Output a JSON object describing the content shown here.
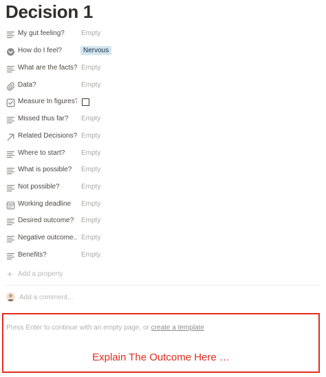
{
  "page": {
    "title": "Decision 1"
  },
  "properties": [
    {
      "icon": "text-lines-icon",
      "label": "My gut feeling?",
      "kind": "text",
      "value": "Empty"
    },
    {
      "icon": "select-circle-icon",
      "label": "How do I feel?",
      "kind": "tag",
      "value": "Nervous"
    },
    {
      "icon": "text-lines-icon",
      "label": "What are the facts?",
      "kind": "text",
      "value": "Empty"
    },
    {
      "icon": "paperclip-icon",
      "label": "Data?",
      "kind": "text",
      "value": "Empty"
    },
    {
      "icon": "checkbox-icon",
      "label": "Measure In figures?",
      "kind": "checkbox",
      "value": false
    },
    {
      "icon": "text-lines-icon",
      "label": "Missed thus far?",
      "kind": "text",
      "value": "Empty"
    },
    {
      "icon": "relation-arrow-icon",
      "label": "Related Decisions?",
      "kind": "text",
      "value": "Empty"
    },
    {
      "icon": "text-lines-icon",
      "label": "Where to start?",
      "kind": "text",
      "value": "Empty"
    },
    {
      "icon": "text-lines-icon",
      "label": "What is possible?",
      "kind": "text",
      "value": "Empty"
    },
    {
      "icon": "text-lines-icon",
      "label": "Not possible?",
      "kind": "text",
      "value": "Empty"
    },
    {
      "icon": "calendar-icon",
      "label": "Working deadline",
      "kind": "text",
      "value": "Empty"
    },
    {
      "icon": "text-lines-icon",
      "label": "Desired outcome?",
      "kind": "text",
      "value": "Empty"
    },
    {
      "icon": "text-lines-icon",
      "label": "Negative outcome...",
      "kind": "text",
      "value": "Empty"
    },
    {
      "icon": "text-lines-icon",
      "label": "Benefits?",
      "kind": "text",
      "value": "Empty"
    }
  ],
  "add_property": {
    "label": "Add a property"
  },
  "comment": {
    "placeholder": "Add a comment..."
  },
  "body": {
    "hint_prefix": "Press Enter to continue with an empty page, or ",
    "hint_link": "create a template",
    "outcome_text": "Explain The Outcome Here …"
  },
  "colors": {
    "annotation_red": "#e32b1c",
    "tag_blue": "#d3e5ef"
  }
}
